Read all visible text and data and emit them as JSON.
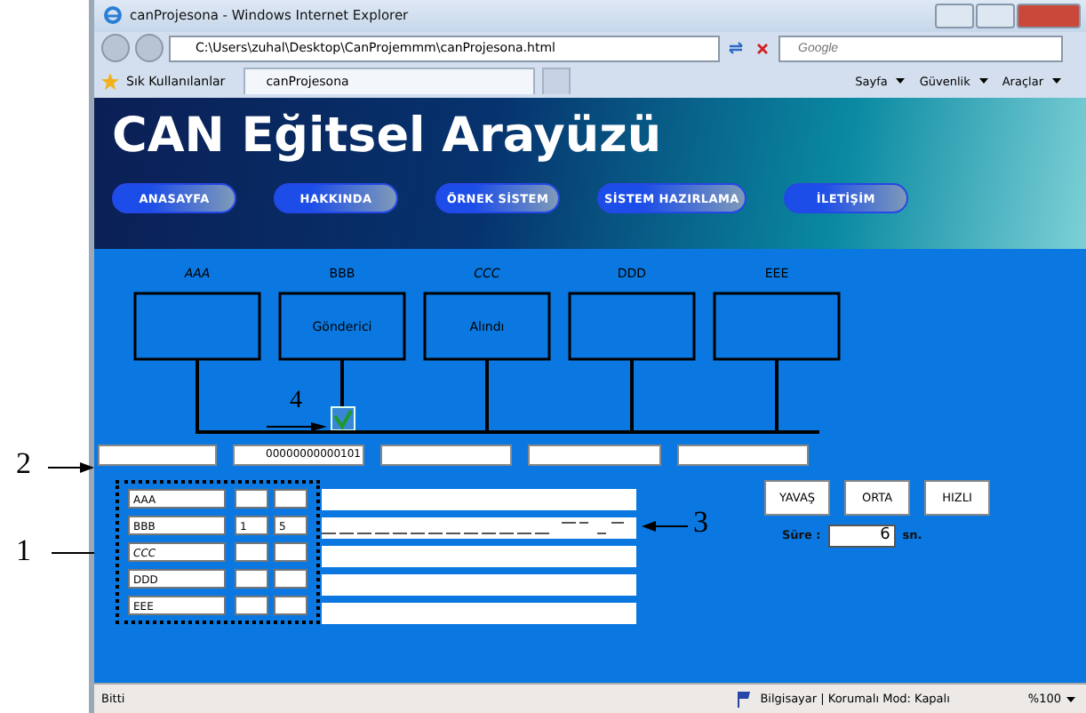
{
  "window": {
    "title": "canProjesona - Windows Internet Explorer"
  },
  "address_bar": {
    "url": "C:\\Users\\zuhal\\Desktop\\CanProjemmm\\canProjesona.html",
    "search_placeholder": "Google"
  },
  "favorites_bar": {
    "favorites": "Sık Kullanılanlar",
    "tabs": [
      {
        "label": "canProjesona",
        "selected": true
      }
    ],
    "menus": [
      "Sayfa",
      "Güvenlik",
      "Araçlar"
    ]
  },
  "page": {
    "title": "CAN Eğitsel Arayüzü",
    "nav": [
      "ANASAYFA",
      "HAKKINDA",
      "ÖRNEK SİSTEM",
      "SİSTEM HAZIRLAMA",
      "İLETİŞİM"
    ],
    "nodes": [
      {
        "label": "AAA",
        "active": false
      },
      {
        "label": "BBB",
        "text": "Gönderici",
        "active": true
      },
      {
        "label": "CCC",
        "text": "Alındı",
        "active": false
      },
      {
        "label": "DDD",
        "active": false
      },
      {
        "label": "EEE",
        "active": false
      }
    ],
    "bus_fields": [
      {
        "kind": "blank"
      },
      {
        "kind": "text",
        "value": "00000000000101"
      },
      {
        "kind": "blank"
      },
      {
        "kind": "blank"
      },
      {
        "kind": "blank"
      }
    ],
    "table_rows": [
      {
        "name": "AAA",
        "waveform": false
      },
      {
        "name": "BBB",
        "column_2": "1",
        "column_3": "5",
        "waveform": true
      },
      {
        "name": "CCC",
        "waveform": false
      },
      {
        "name": "DDD",
        "waveform": false
      },
      {
        "name": "EEE",
        "waveform": false
      }
    ],
    "speed_buttons": [
      "YAVAŞ",
      "ORTA",
      "HIZLI"
    ],
    "duration": {
      "label": "Süre :",
      "value": "6",
      "unit": "sn."
    }
  },
  "callouts": [
    "1",
    "2",
    "3",
    "4"
  ],
  "status_bar": {
    "text": "Bitti",
    "zone": "Bilgisayar | Korumalı Mod: Kapalı",
    "zoom": "%100"
  }
}
